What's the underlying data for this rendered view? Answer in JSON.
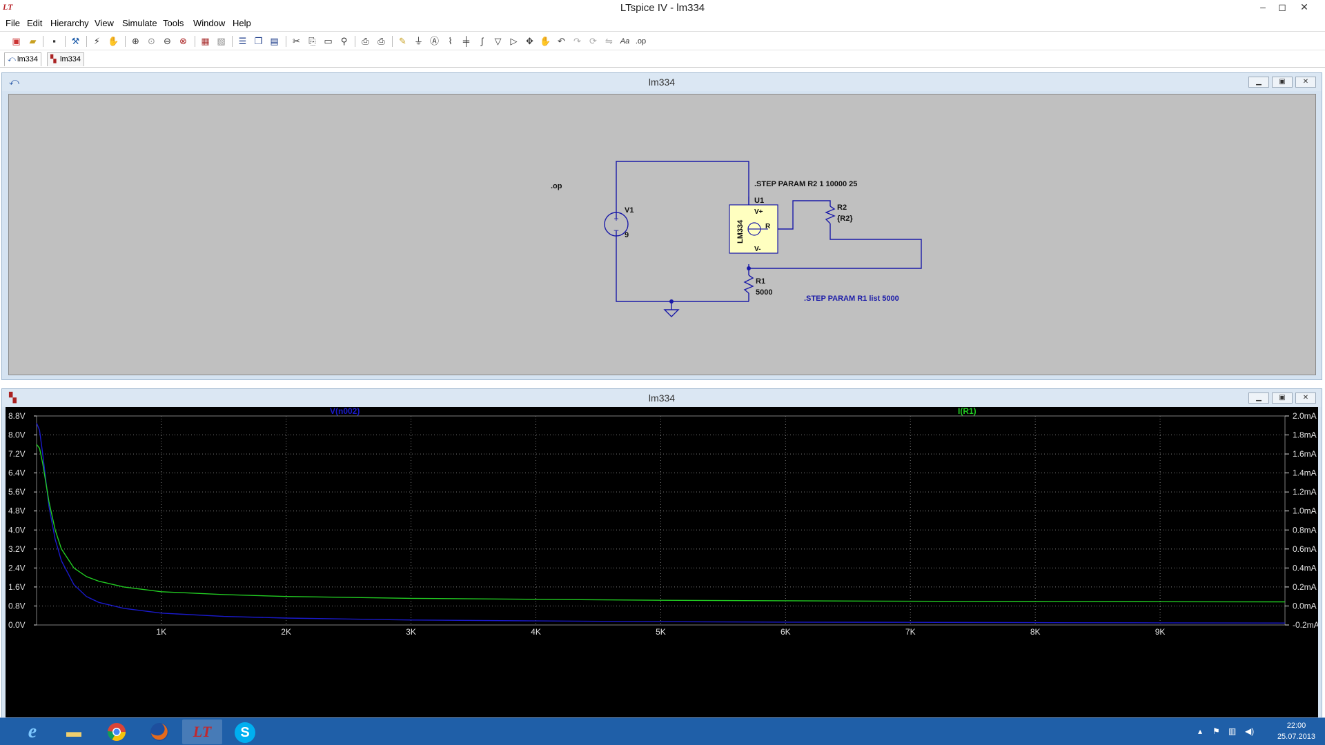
{
  "app": {
    "logo": "LT",
    "title": "LTspice IV - lm334",
    "controls": [
      "–",
      "◻",
      "✕"
    ]
  },
  "menu": [
    "File",
    "Edit",
    "Hierarchy",
    "View",
    "Simulate",
    "Tools",
    "Window",
    "Help"
  ],
  "tabs": [
    {
      "label": "lm334",
      "icon": "schematic-icon"
    },
    {
      "label": "lm334",
      "icon": "waveform-icon"
    }
  ],
  "schematic": {
    "title": "lm334",
    "op": ".op",
    "step_r2": ".STEP PARAM R2 1 10000 25",
    "step_r1": ".STEP PARAM R1 list 5000",
    "v1_name": "V1",
    "v1_value": "9",
    "u1_name": "U1",
    "u1_part": "LM334",
    "pin_vplus": "V+",
    "pin_r": "R",
    "pin_vminus": "V-",
    "r2_name": "R2",
    "r2_value": "{R2}",
    "r1_name": "R1",
    "r1_value": "5000"
  },
  "plot": {
    "title": "lm334",
    "left_trace_label": "V(n002)",
    "right_trace_label": "I(R1)"
  },
  "chart_data": {
    "type": "line",
    "title": "",
    "xlabel": "",
    "ylabel": "",
    "x_ticks": [
      "1K",
      "2K",
      "3K",
      "4K",
      "5K",
      "6K",
      "7K",
      "8K",
      "9K"
    ],
    "xlim": [
      1,
      10000
    ],
    "y_left_ticks": [
      "8.8V",
      "8.0V",
      "7.2V",
      "6.4V",
      "5.6V",
      "4.8V",
      "4.0V",
      "3.2V",
      "2.4V",
      "1.6V",
      "0.8V",
      "0.0V"
    ],
    "ylim_left": [
      0,
      8.8
    ],
    "y_right_ticks": [
      "2.0mA",
      "1.8mA",
      "1.6mA",
      "1.4mA",
      "1.2mA",
      "1.0mA",
      "0.8mA",
      "0.6mA",
      "0.4mA",
      "0.2mA",
      "0.0mA",
      "-0.2mA"
    ],
    "ylim_right": [
      -0.2,
      2.0
    ],
    "grid": true,
    "series": [
      {
        "name": "V(n002)",
        "color": "#1a1acc",
        "axis": "left",
        "x": [
          1,
          25,
          50,
          100,
          150,
          200,
          300,
          400,
          500,
          700,
          1000,
          1500,
          2000,
          3000,
          4000,
          5000,
          6000,
          7000,
          8000,
          9000,
          10000
        ],
        "y": [
          8.5,
          8.2,
          7.2,
          5.0,
          3.6,
          2.7,
          1.7,
          1.2,
          0.95,
          0.7,
          0.5,
          0.36,
          0.29,
          0.21,
          0.17,
          0.14,
          0.12,
          0.11,
          0.1,
          0.09,
          0.08
        ]
      },
      {
        "name": "I(R1)",
        "color": "#22cc22",
        "axis": "right",
        "x": [
          1,
          25,
          50,
          100,
          150,
          200,
          300,
          400,
          500,
          700,
          1000,
          1500,
          2000,
          3000,
          4000,
          5000,
          6000,
          7000,
          8000,
          9000,
          10000
        ],
        "y": [
          1.7,
          1.66,
          1.5,
          1.1,
          0.8,
          0.6,
          0.4,
          0.31,
          0.26,
          0.2,
          0.15,
          0.12,
          0.1,
          0.08,
          0.07,
          0.06,
          0.055,
          0.05,
          0.047,
          0.045,
          0.043
        ]
      }
    ]
  },
  "taskbar": {
    "apps": [
      "internet-explorer-icon",
      "file-explorer-icon",
      "chrome-icon",
      "firefox-icon",
      "ltspice-icon",
      "skype-icon"
    ],
    "time": "22:00",
    "date": "25.07.2013"
  },
  "colors": {
    "schematic_bg": "#c0c0c0",
    "wire": "#1a1aa8",
    "plot_bg": "#000000",
    "grid": "#808080"
  }
}
